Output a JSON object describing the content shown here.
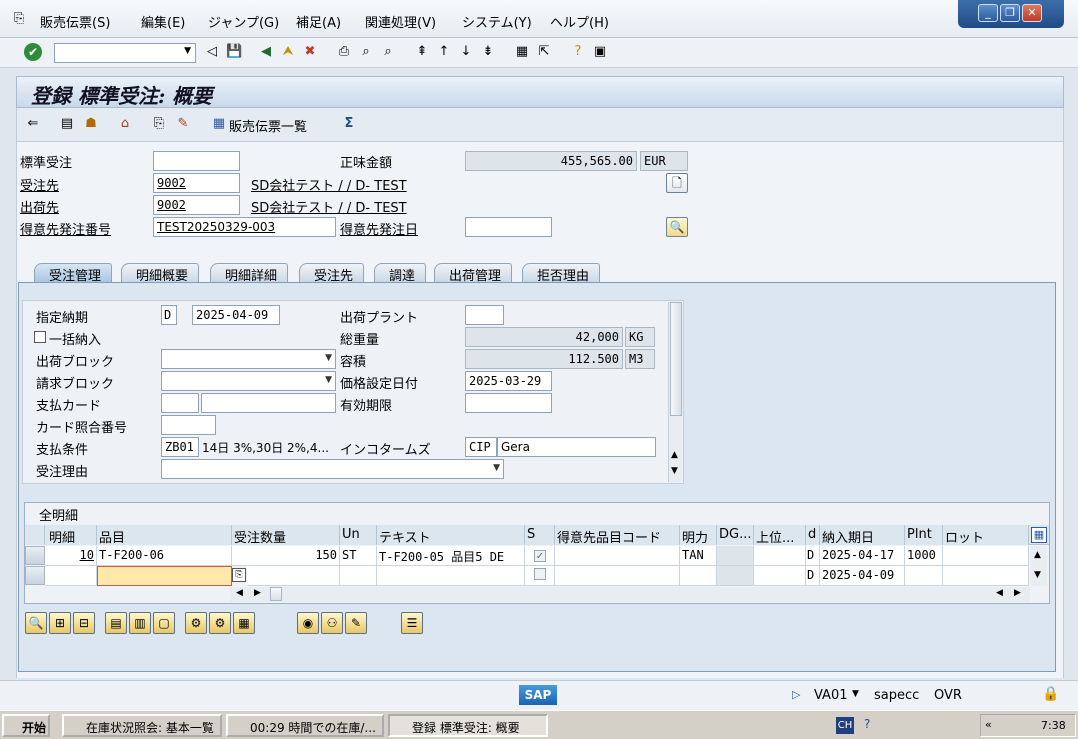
{
  "menu": {
    "items": [
      "販売伝票(S)",
      "編集(E)",
      "ジャンプ(G)",
      "補足(A)",
      "関連処理(V)",
      "システム(Y)",
      "ヘルプ(H)"
    ]
  },
  "window_controls": [
    "minimize-icon",
    "restore-icon",
    "close-icon"
  ],
  "title": "登録 標準受注: 概要",
  "app_toolbar": {
    "sales_doc_list_label": "販売伝票一覧"
  },
  "header": {
    "standard_order": {
      "label": "標準受注",
      "value": ""
    },
    "net_value": {
      "label": "正味金額",
      "value": "455,565.00",
      "currency": "EUR"
    },
    "sold_to": {
      "label": "受注先",
      "value": "9002",
      "name": "SD会社テスト / / D- TEST"
    },
    "ship_to": {
      "label": "出荷先",
      "value": "9002",
      "name": "SD会社テスト / / D- TEST"
    },
    "cust_po_number": {
      "label": "得意先発注番号",
      "value": "TEST20250329-003"
    },
    "cust_po_date": {
      "label": "得意先発注日",
      "value": ""
    }
  },
  "tabs": [
    {
      "label": "受注管理",
      "active": true
    },
    {
      "label": "明細概要",
      "active": false
    },
    {
      "label": "明細詳細",
      "active": false
    },
    {
      "label": "受注先",
      "active": false
    },
    {
      "label": "調達",
      "active": false
    },
    {
      "label": "出荷管理",
      "active": false
    },
    {
      "label": "拒否理由",
      "active": false
    }
  ],
  "sales_tab": {
    "req_deliv_date": {
      "label": "指定納期",
      "period": "D",
      "value": "2025-04-09"
    },
    "delivery_plant": {
      "label": "出荷プラント",
      "value": ""
    },
    "complete_delivery": {
      "label": "一括納入",
      "checked": false
    },
    "total_weight": {
      "label": "総重量",
      "value": "42,000",
      "unit": "KG"
    },
    "delivery_block": {
      "label": "出荷ブロック",
      "value": ""
    },
    "volume": {
      "label": "容積",
      "value": "112.500",
      "unit": "M3"
    },
    "billing_block": {
      "label": "請求ブロック",
      "value": ""
    },
    "pricing_date": {
      "label": "価格設定日付",
      "value": "2025-03-29"
    },
    "payment_card": {
      "label": "支払カード",
      "value1": "",
      "value2": ""
    },
    "valid_to": {
      "label": "有効期限",
      "value": ""
    },
    "card_verif": {
      "label": "カード照合番号",
      "value": ""
    },
    "payment_terms": {
      "label": "支払条件",
      "code": "ZB01",
      "text": "14日 3%,30日 2%,4..."
    },
    "incoterms": {
      "label": "インコタームズ",
      "code": "CIP",
      "text": "Gera"
    },
    "order_reason": {
      "label": "受注理由",
      "value": ""
    }
  },
  "items_table": {
    "title": "全明細",
    "columns": [
      "明細",
      "品目",
      "受注数量",
      "Un",
      "テキスト",
      "S",
      "得意先品目コード",
      "明力",
      "DG...",
      "上位...",
      "d",
      "納入期日",
      "Plnt",
      "ロット"
    ],
    "rows": [
      {
        "item": "10",
        "material": "T-F200-06",
        "qty": "150",
        "un": "ST",
        "text": "T-F200-05 品目5 DE",
        "s_checked": true,
        "cust_mat": "",
        "cat": "TAN",
        "dg": "",
        "higher": "",
        "d": "D",
        "deliv_date": "2025-04-17",
        "plant": "1000",
        "batch": ""
      },
      {
        "item": "",
        "material": "",
        "qty": "",
        "un": "",
        "text": "",
        "s_checked": false,
        "cust_mat": "",
        "cat": "",
        "dg": "",
        "higher": "",
        "d": "D",
        "deliv_date": "2025-04-09",
        "plant": "",
        "batch": ""
      }
    ]
  },
  "status": {
    "transaction": "VA01",
    "server": "sapecc",
    "mode": "OVR"
  },
  "taskbar": {
    "start": "开始",
    "tasks": [
      "在庫状況照会: 基本一覧",
      "00:29 時間での在庫/...",
      "登録 標準受注: 概要"
    ],
    "lang": "CH",
    "clock": "7:38"
  },
  "colors": {
    "accent": "#2b5c9c",
    "tab_active": "#a9c4df",
    "input_highlight": "#ffe9a8"
  }
}
